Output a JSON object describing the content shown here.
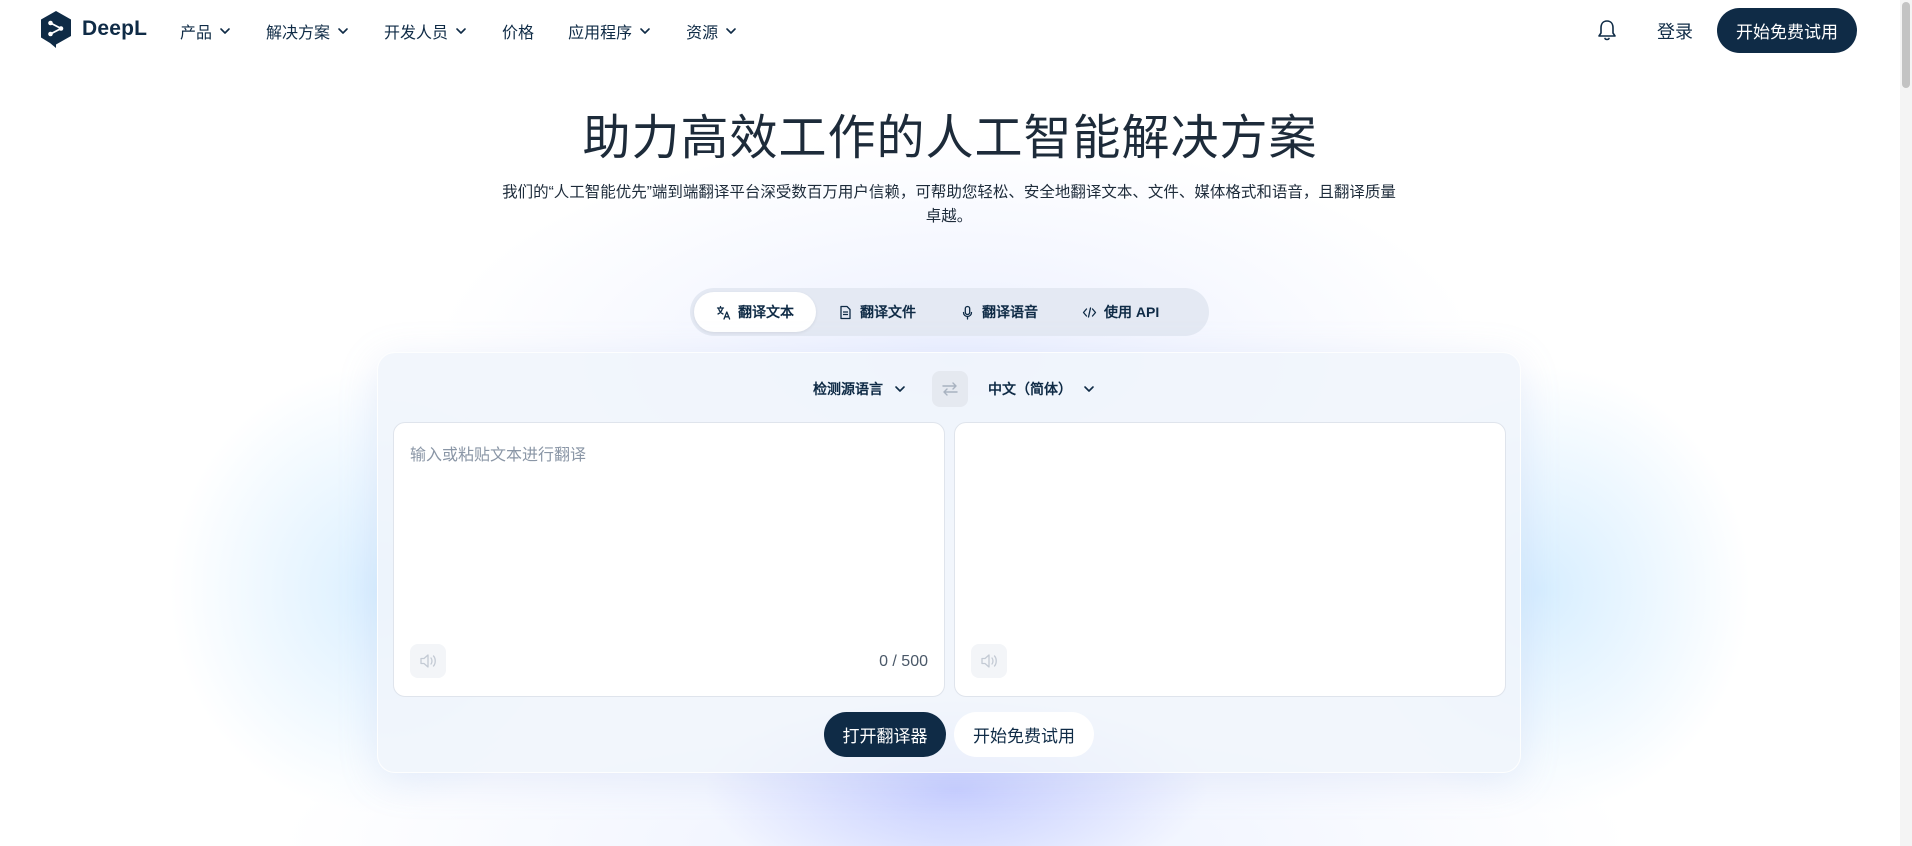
{
  "brand": {
    "name": "DeepL",
    "colors": {
      "navy": "#0f2b46",
      "tab_bg": "#e4e9f3"
    }
  },
  "nav": {
    "items": [
      {
        "label": "产品",
        "has_dropdown": true
      },
      {
        "label": "解决方案",
        "has_dropdown": true
      },
      {
        "label": "开发人员",
        "has_dropdown": true
      },
      {
        "label": "价格",
        "has_dropdown": false
      },
      {
        "label": "应用程序",
        "has_dropdown": true
      },
      {
        "label": "资源",
        "has_dropdown": true
      }
    ],
    "login": "登录",
    "trial": "开始免费试用",
    "icons": [
      "bell-icon",
      "chevron-down-icon"
    ]
  },
  "hero": {
    "title": "助力高效工作的人工智能解决方案",
    "subtitle": "我们的“人工智能优先”端到端翻译平台深受数百万用户信赖，可帮助您轻松、安全地翻译文本、文件、媒体格式和语音，且翻译质量卓越。"
  },
  "tabs": [
    {
      "label": "翻译文本",
      "icon": "translate-icon",
      "active": true
    },
    {
      "label": "翻译文件",
      "icon": "document-icon",
      "active": false
    },
    {
      "label": "翻译语音",
      "icon": "microphone-icon",
      "active": false
    },
    {
      "label": "使用 API",
      "icon": "code-icon",
      "active": false
    }
  ],
  "translator": {
    "source_lang": "检测源语言",
    "target_lang": "中文（简体）",
    "placeholder": "输入或粘贴文本进行翻译",
    "counter": "0 / 500",
    "open_button": "打开翻译器",
    "trial_button": "开始免费试用"
  }
}
